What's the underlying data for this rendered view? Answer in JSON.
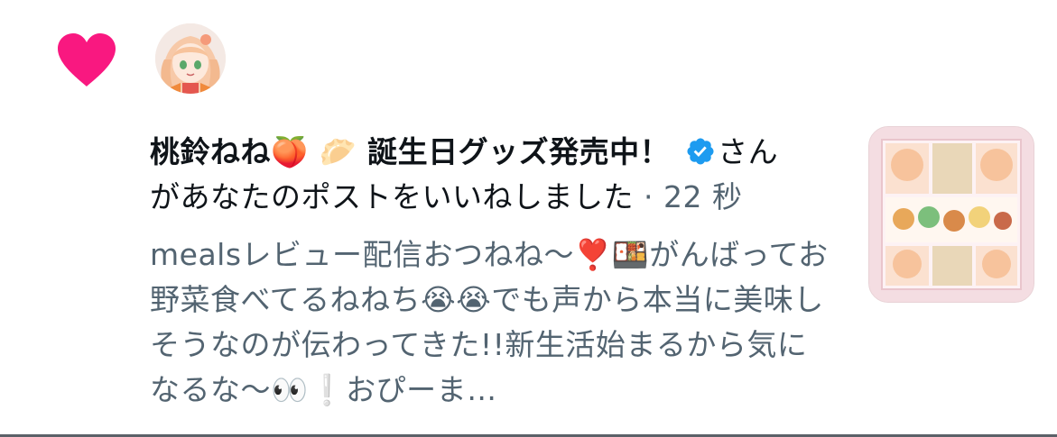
{
  "notification": {
    "name": "桃鈴ねね🍑 🥟 誕生日グッズ発売中！",
    "after_name": "さん",
    "action": "があなたのポストをいいねしました",
    "separator": " · ",
    "time": "22 秒",
    "post_preview": "mealsレビュー配信おつねね〜❣️🍱がんばってお野菜食べてるねねち😭😭でも声から本当に美味しそうなのが伝わってきた!!新生活始まるから気になるな〜👀❕おぴーま…"
  },
  "colors": {
    "heart": "#f91880",
    "verified": "#1d9bf0",
    "secondary_text": "#536471",
    "primary_text": "#0f1419"
  },
  "icons": {
    "like": "heart-icon",
    "verified": "verified-badge-icon"
  }
}
